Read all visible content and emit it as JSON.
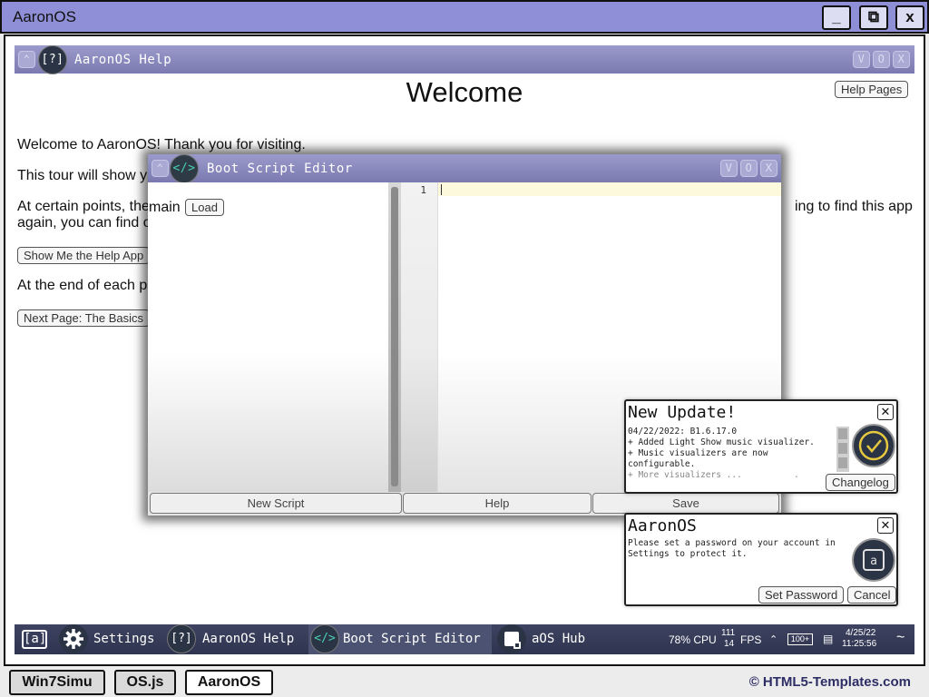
{
  "outer": {
    "title": "AaronOS",
    "controls": [
      "_",
      "⧉",
      "x"
    ]
  },
  "help": {
    "window_title": "AaronOS Help",
    "icon_text": "[?]",
    "heading": "Welcome",
    "help_pages_button": "Help Pages",
    "para1": "Welcome to AaronOS! Thank you for visiting.",
    "para2": "This tour will show y",
    "para3a": "At certain points, the",
    "para3b": "ing to find this app",
    "para3c": "again, you can find o",
    "show_me_button": "Show Me the Help App",
    "para4": "At the end of each p",
    "next_page_button": "Next Page: The Basics"
  },
  "editor": {
    "window_title": "Boot Script Editor",
    "icon_text": "</>",
    "main_label": "main",
    "load_button": "Load",
    "line_number": "1",
    "footer": {
      "new_script": "New Script",
      "help": "Help",
      "save": "Save"
    }
  },
  "notifications": {
    "update": {
      "title": "New Update!",
      "lines": [
        "04/22/2022: B1.6.17.0",
        "+ Added Light Show music visualizer.",
        "+ Music visualizers are now",
        "configurable.",
        "+ More visualizers ...          ."
      ],
      "button": "Changelog"
    },
    "password": {
      "title": "AaronOS",
      "lines": [
        "Please set a password on your account in",
        "Settings to protect it."
      ],
      "set_button": "Set Password",
      "cancel_button": "Cancel"
    },
    "close_glyph": "✕"
  },
  "taskbar": {
    "start_icon": "[a]",
    "items": [
      {
        "label": "Settings",
        "icon": "gear-icon"
      },
      {
        "label": "AaronOS Help",
        "icon": "help-icon",
        "icon_text": "[?]"
      },
      {
        "label": "Boot Script Editor",
        "icon": "code-icon",
        "icon_text": "</>"
      },
      {
        "label": "aOS Hub",
        "icon": "hub-icon"
      }
    ],
    "tray": {
      "cpu": "78% CPU",
      "fps_top": "111",
      "fps_bottom": "14",
      "fps_label": "FPS",
      "battery": "100+",
      "date": "4/25/22",
      "time": "11:25:56",
      "wifi": "~"
    }
  },
  "bottom": {
    "buttons": [
      "Win7Simu",
      "OS.js",
      "AaronOS"
    ],
    "credit": "© HTML5-Templates.com"
  },
  "colors": {
    "outer_titlebar": "#8f8fd8",
    "window_titlebar": "#8888bf",
    "taskbar": "#363b58",
    "credit": "#2e2e66"
  }
}
